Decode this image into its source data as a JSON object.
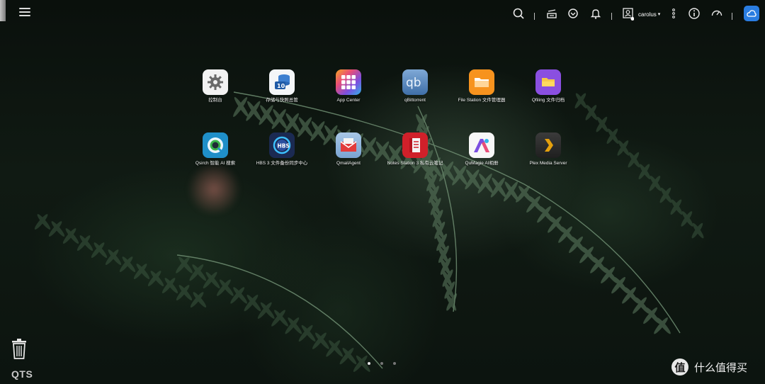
{
  "topbar": {
    "icons": [
      "search-icon",
      "task-icon",
      "sync-icon",
      "bell-icon",
      "more-icon",
      "info-icon",
      "dashboard-icon",
      "cloud-icon"
    ],
    "username": "carolus",
    "user_caret": "▾"
  },
  "apps": [
    {
      "label": "控制台",
      "icon": "gear-icon"
    },
    {
      "label": "存储与快照总管",
      "icon": "storage-icon"
    },
    {
      "label": "App Center",
      "icon": "app-grid-icon"
    },
    {
      "label": "qBittorrent",
      "icon": "qbittorrent-icon"
    },
    {
      "label": "File Station 文件管理器",
      "icon": "folder-icon"
    },
    {
      "label": "Qfiling 文件归档",
      "icon": "archive-folder-icon"
    },
    {
      "label": "Qsirch 智能 AI 搜索",
      "icon": "qsirch-icon"
    },
    {
      "label": "HBS 3 文件备份同步中心",
      "icon": "hbs-icon"
    },
    {
      "label": "QmailAgent",
      "icon": "mail-icon"
    },
    {
      "label": "Notes Station 3 私有云笔记",
      "icon": "notes-icon"
    },
    {
      "label": "QuMagie AI相册",
      "icon": "qumagie-icon"
    },
    {
      "label": "Plex Media Server",
      "icon": "plex-icon"
    }
  ],
  "bottom": {
    "brand": "QTS",
    "pages": 3,
    "active_page": 1,
    "watermark_badge": "值",
    "watermark_text": "什么值得买"
  },
  "colors": {
    "cloud_button": "#2a7de1",
    "file_station": "#f7931e",
    "qfiling": "#8a4fe0",
    "notes": "#d0202a"
  }
}
